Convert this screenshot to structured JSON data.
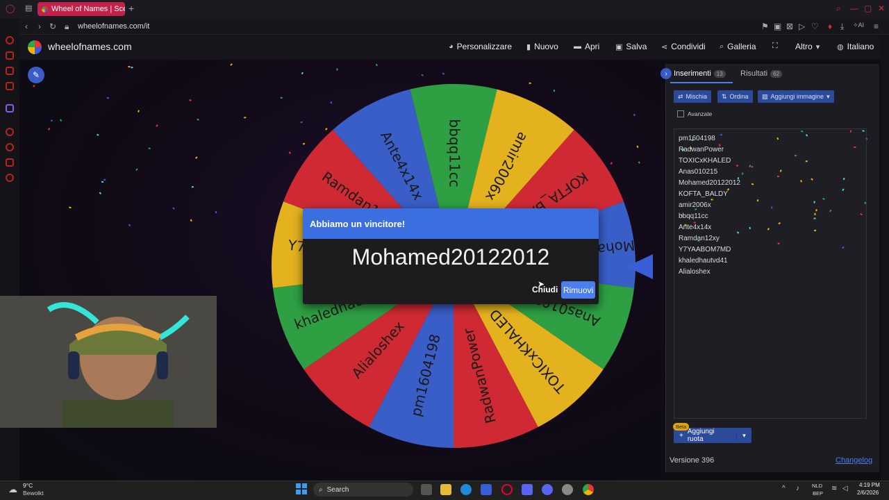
{
  "browser": {
    "tab_title": "Wheel of Names | Sceli",
    "new_tab": "+",
    "url": "wheelofnames.com/it"
  },
  "site": {
    "name": "wheelofnames.com",
    "menu": {
      "customize": "Personalizzare",
      "new": "Nuovo",
      "open": "Apri",
      "save": "Salva",
      "share": "Condividi",
      "gallery": "Galleria",
      "more": "Altro",
      "language": "Italiano"
    }
  },
  "wheel": {
    "segments": [
      {
        "label": "bbqq11cc",
        "color": "#2ea043"
      },
      {
        "label": "amir2006x",
        "color": "#e3b21e"
      },
      {
        "label": "KOFTA_BALDY",
        "color": "#cf2a34"
      },
      {
        "label": "Mohamed20122012",
        "color": "#3a5ec8"
      },
      {
        "label": "Anas010215",
        "color": "#2ea043"
      },
      {
        "label": "TOXICxKHALED",
        "color": "#e3b21e"
      },
      {
        "label": "RadwanPower",
        "color": "#cf2a34"
      },
      {
        "label": "pm1604198",
        "color": "#3a5ec8"
      },
      {
        "label": "Alialoshex",
        "color": "#cf2a34"
      },
      {
        "label": "khaledhautvd41",
        "color": "#2ea043"
      },
      {
        "label": "Y7YAABOM7MD",
        "color": "#e3b21e"
      },
      {
        "label": "Ramdan12xy",
        "color": "#cf2a34"
      },
      {
        "label": "Ante4x14x",
        "color": "#3a5ec8"
      }
    ]
  },
  "dialog": {
    "title": "Abbiamo un vincitore!",
    "winner": "Mohamed20122012",
    "close": "Chiudi",
    "remove": "Rimuovi"
  },
  "panel": {
    "tab_entries": "Inserimenti",
    "entries_count": "13",
    "tab_results": "Risultati",
    "results_count": "62",
    "shuffle": "Mischia",
    "sort": "Ordina",
    "add_image": "Aggiungi immagine",
    "advanced": "Avanzate",
    "entries": [
      "pm1604198",
      "RadwanPower",
      "TOXICxKHALED",
      "Anas010215",
      "Mohamed20122012",
      "KOFTA_BALDY",
      "amir2006x",
      "bbqq11cc",
      "Ante4x14x",
      "Ramdan12xy",
      "Y7YAABOM7MD",
      "khaledhautvd41",
      "Alialoshex"
    ],
    "beta": "Beta",
    "add_wheel": "Aggiungi ruota",
    "version": "Versione 396",
    "changelog": "Changelog"
  },
  "taskbar": {
    "temperature": "9°C",
    "condition": "Bewolkt",
    "search": "Search",
    "lang_line1": "NLD",
    "lang_line2": "BEP",
    "time": "4:19 PM",
    "date": "2/6/2026"
  }
}
